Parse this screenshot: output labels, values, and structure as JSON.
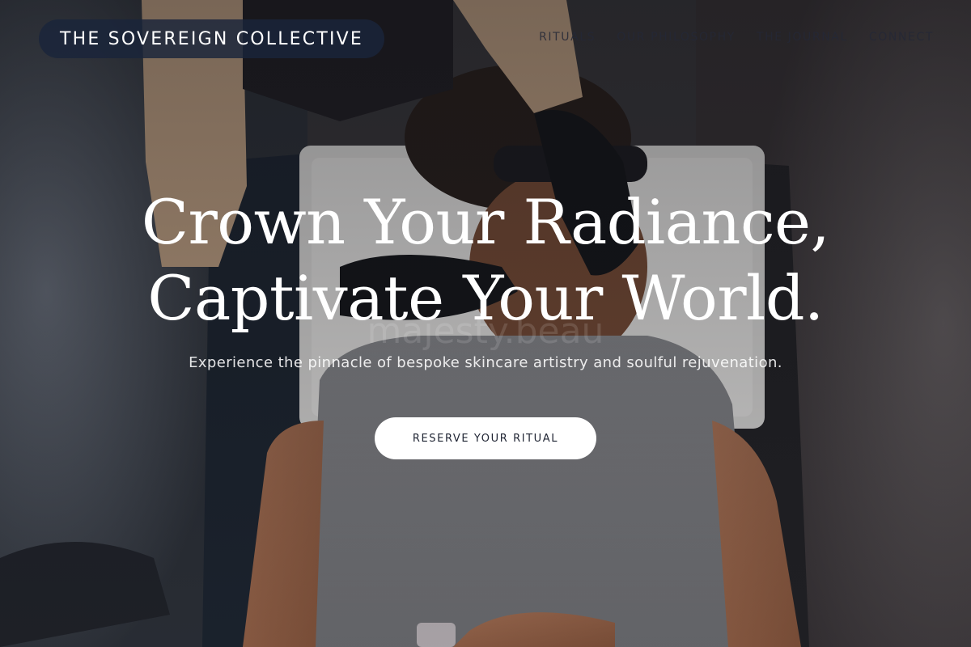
{
  "brand": {
    "name": "THE SOVEREIGN COLLECTIVE"
  },
  "nav": {
    "items": [
      {
        "label": "RITUALS"
      },
      {
        "label": "OUR PHILOSOPHY"
      },
      {
        "label": "THE JOURNAL"
      },
      {
        "label": "CONNECT"
      }
    ]
  },
  "hero": {
    "headline_line1": "Crown Your Radiance,",
    "headline_line2": "Captivate Your World.",
    "subheadline": "Experience the pinnacle of bespoke skincare artistry and soulful rejuvenation.",
    "cta_label": "RESERVE YOUR RITUAL",
    "photo_icon": "spa-treatment-photo-icon",
    "watermark": "majesty.beau"
  },
  "colors": {
    "brand_pill_bg": "#1a243a",
    "cta_bg": "#ffffff",
    "cta_text": "#1f2433",
    "headline": "#ffffff"
  }
}
